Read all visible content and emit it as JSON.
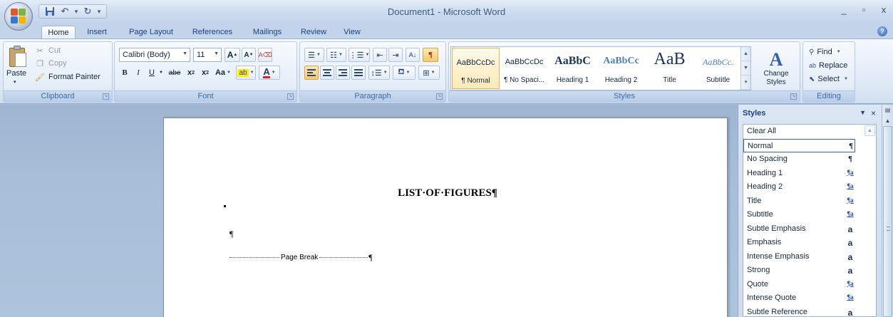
{
  "window": {
    "title": "Document1 - Microsoft Word",
    "controls": [
      "_",
      "▫",
      "x"
    ]
  },
  "tabs": [
    "Home",
    "Insert",
    "Page Layout",
    "References",
    "Mailings",
    "Review",
    "View"
  ],
  "clipboard": {
    "paste": "Paste",
    "cut": "Cut",
    "copy": "Copy",
    "format_painter": "Format Painter",
    "group_label": "Clipboard"
  },
  "font": {
    "name": "Calibri (Body)",
    "size": "11",
    "group_label": "Font",
    "grow": "A",
    "shrink": "A",
    "bold": "B",
    "italic": "I",
    "underline": "U",
    "strike": "abe",
    "subscript": "x",
    "superscript": "x",
    "change_case": "Aa",
    "highlight": "ab",
    "font_color": "A"
  },
  "paragraph": {
    "group_label": "Paragraph"
  },
  "styles": {
    "group_label": "Styles",
    "change_styles": "Change Styles",
    "gallery": [
      {
        "preview": "AaBbCcDc",
        "name": "¶ Normal"
      },
      {
        "preview": "AaBbCcDc",
        "name": "¶ No Spaci..."
      },
      {
        "preview": "AaBbC",
        "name": "Heading 1"
      },
      {
        "preview": "AaBbCc",
        "name": "Heading 2"
      },
      {
        "preview": "AaB",
        "name": "Title"
      },
      {
        "preview": "AaBbCc.",
        "name": "Subtitle"
      }
    ]
  },
  "editing": {
    "group_label": "Editing",
    "find": "Find",
    "replace": "Replace",
    "select": "Select"
  },
  "document": {
    "heading": "LIST·OF·FIGURES¶",
    "pilcrow": "¶",
    "page_break": "Page Break"
  },
  "styles_pane": {
    "title": "Styles",
    "items": [
      {
        "label": "Clear All",
        "icon": ""
      },
      {
        "label": "Normal",
        "icon": "¶"
      },
      {
        "label": "No Spacing",
        "icon": "¶"
      },
      {
        "label": "Heading 1",
        "icon": "¶a"
      },
      {
        "label": "Heading 2",
        "icon": "¶a"
      },
      {
        "label": "Title",
        "icon": "¶a"
      },
      {
        "label": "Subtitle",
        "icon": "¶a"
      },
      {
        "label": "Subtle Emphasis",
        "icon": "a"
      },
      {
        "label": "Emphasis",
        "icon": "a"
      },
      {
        "label": "Intense Emphasis",
        "icon": "a"
      },
      {
        "label": "Strong",
        "icon": "a"
      },
      {
        "label": "Quote",
        "icon": "¶a"
      },
      {
        "label": "Intense Quote",
        "icon": "¶a"
      },
      {
        "label": "Subtle Reference",
        "icon": "a"
      }
    ]
  },
  "colors": {
    "accent": "#15428b",
    "ribbon_bg": "#dfe9f5",
    "selection": "#fde9b8",
    "workspace": "#a9bed6"
  }
}
